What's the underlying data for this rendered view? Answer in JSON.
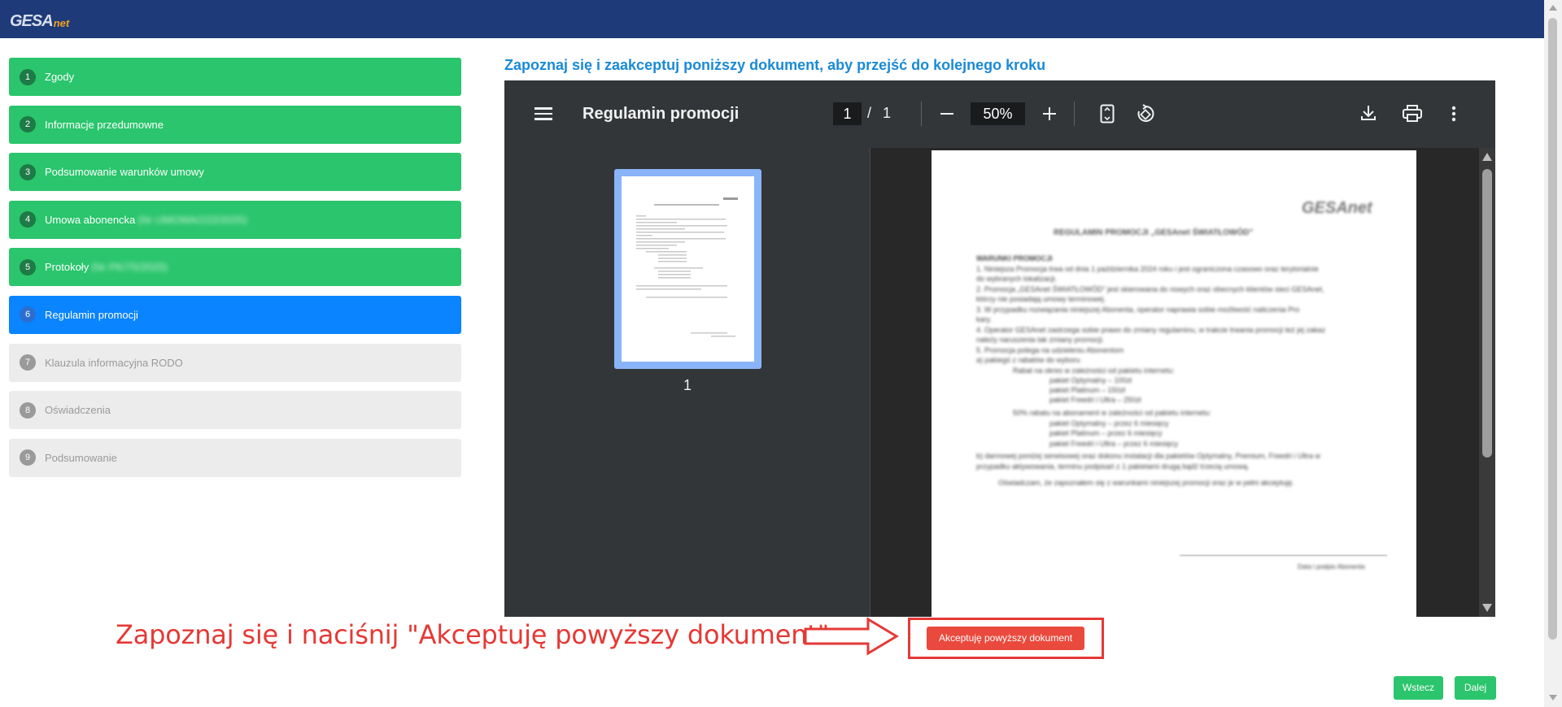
{
  "logo": {
    "part1": "GESA",
    "part2": "net"
  },
  "steps": [
    {
      "num": "1",
      "label": "Zgody",
      "state": "done",
      "extra": ""
    },
    {
      "num": "2",
      "label": "Informacje przedumowne",
      "state": "done",
      "extra": ""
    },
    {
      "num": "3",
      "label": "Podsumowanie warunków umowy",
      "state": "done",
      "extra": ""
    },
    {
      "num": "4",
      "label": "Umowa abonencka",
      "state": "done",
      "extra": "(Nr UMOWA/222/2025)"
    },
    {
      "num": "5",
      "label": "Protokoły",
      "state": "done",
      "extra": "(Nr PK/75/2025)"
    },
    {
      "num": "6",
      "label": "Regulamin promocji",
      "state": "active",
      "extra": ""
    },
    {
      "num": "7",
      "label": "Klauzula informacyjna RODO",
      "state": "pending",
      "extra": ""
    },
    {
      "num": "8",
      "label": "Oświadczenia",
      "state": "pending",
      "extra": ""
    },
    {
      "num": "9",
      "label": "Podsumowanie",
      "state": "pending",
      "extra": ""
    }
  ],
  "heading": "Zapoznaj się i zaakceptuj poniższy dokument, aby przejść do kolejnego kroku",
  "viewer": {
    "title": "Regulamin promocji",
    "current_page": "1",
    "page_sep": "/",
    "total_pages": "1",
    "zoom": "50%",
    "thumbnail_label": "1",
    "icons": [
      "menu-icon",
      "zoom-out-icon",
      "zoom-in-icon",
      "fit-page-icon",
      "rotate-icon",
      "download-icon",
      "print-icon",
      "more-icon"
    ]
  },
  "document": {
    "logo_text": "GESAnet",
    "title": "REGULAMIN PROMOCJI „GESAnet ŚWIATŁOWÓD”",
    "lines": [
      "WARUNKI PROMOCJI",
      "1. Niniejsza Promocja trwa od dnia 1 października 2024 roku i jest ograniczona czasowo oraz terytorialnie",
      "do wybranych lokalizacji.",
      "2. Promocja „GESAnet ŚWIATŁOWÓD” jest skierowana do nowych oraz obecnych klientów sieci GESAnet,",
      "którzy nie posiadają umowy terminowej.",
      "3. W przypadku rozwiązania niniejszej Abonenta, operator naprawia sobie możliwość naliczenia Pro",
      "kary.",
      "4. Operator GESAnet zastrzega sobie prawo do zmiany regulaminu, w trakcie trwania promocji też jej zakaz",
      "należy naruszenia tak zmiany promocji.",
      "5. Promocja polega na udzieleniu Abonentom",
      "a) pakiegó z rabatów do wyboru",
      "Rabat na okres w zależności od pakietu internetu:",
      "pakiet Optymalny – 100zł",
      "pakiet Platinum – 150zł",
      "pakiet Freedri i Ultra – 250zł",
      "50% rabatu na abonament w zależności od pakietu internetu:",
      "pakiet Optymalny – przez 6 miesięcy",
      "pakiet Platinum – przez 6 miesięcy",
      "pakiet Freedri i Ultra – przez 6 miesięcy",
      "b) darmowej poniżej serwisowej oraz dokonu instalacji dla pakietów Optymalny, Premium, Freedri i Ultra w",
      "przypadku aktywowania, terminu podpisań z 1 pakietami drugą bądź trzecią umową.",
      "Oświadczam, że zapoznałem się z warunkami niniejszej promocji oraz je w pełni akceptuję.",
      "Data i podpis Abonenta"
    ]
  },
  "annotation": {
    "instruction": "Zapoznaj się i naciśnij \"Akceptuję powyższy dokument\""
  },
  "accept_label": "Akceptuję powyższy dokument",
  "nav": {
    "back_label": "Wstecz",
    "next_label": "Dalej"
  },
  "colors": {
    "topbar": "#1e3a78",
    "step_done": "#2ac56c",
    "step_active": "#0a84ff",
    "step_pending": "#ececec",
    "heading": "#1a8ad6",
    "accept": "#ea4a3d",
    "annotation": "#e53935"
  }
}
